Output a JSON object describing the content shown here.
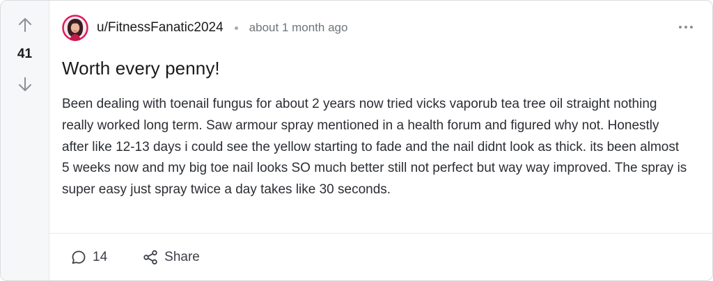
{
  "post": {
    "votes": "41",
    "author": "u/FitnessFanatic2024",
    "timestamp": "about 1 month ago",
    "title": "Worth every penny!",
    "body": "Been dealing with toenail fungus for about 2 years now tried vicks vaporub tea tree oil straight nothing really worked long term. Saw armour spray mentioned in a health forum and figured why not. Honestly after like 12-13 days i could see the yellow starting to fade and the nail didnt look as thick. its been almost 5 weeks now and my big toe nail looks SO much better still not perfect but way way improved. The spray is super easy just spray twice a day takes like 30 seconds.",
    "comment_count": "14",
    "share_label": "Share"
  },
  "icons": {
    "upvote": "arrow-up-icon",
    "downvote": "arrow-down-icon",
    "more": "more-horizontal-icon",
    "comment": "comment-icon",
    "share": "share-icon",
    "avatar": "user-avatar"
  },
  "colors": {
    "rail_background": "#f6f7f8",
    "border": "#d9dcdf",
    "muted_text": "#6f7479",
    "avatar_accent": "#e0195b"
  }
}
